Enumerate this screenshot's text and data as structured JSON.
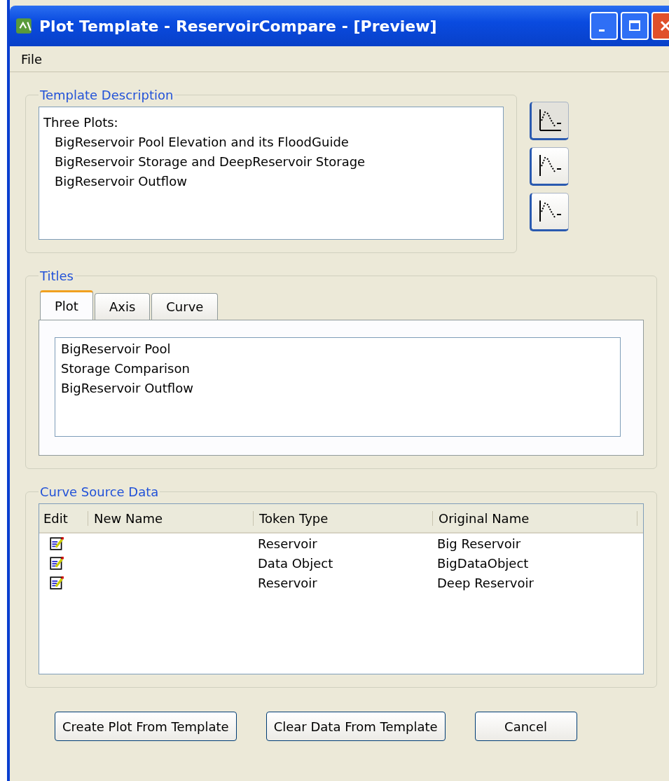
{
  "window": {
    "title": "Plot Template - ReservoirCompare - [Preview]"
  },
  "menu": [
    "File"
  ],
  "template_description": {
    "title": "Template Description",
    "heading": "Three Plots:",
    "lines": [
      "BigReservoir Pool Elevation and its FloodGuide",
      "BigReservoir Storage and DeepReservoir Storage",
      "BigReservoir Outflow"
    ],
    "plot_buttons": [
      {
        "selected": true
      },
      {
        "selected": false
      },
      {
        "selected": false
      }
    ]
  },
  "titles": {
    "title": "Titles",
    "tabs": [
      {
        "label": "Plot",
        "selected": true
      },
      {
        "label": "Axis",
        "selected": false
      },
      {
        "label": "Curve",
        "selected": false
      }
    ],
    "lines": [
      "BigReservoir Pool",
      "Storage Comparison",
      "BigReservoir Outflow"
    ]
  },
  "curve_source_data": {
    "title": "Curve Source Data",
    "columns": [
      "Edit",
      "New Name",
      "Token Type",
      "Original Name"
    ],
    "rows": [
      {
        "token_type": "Reservoir",
        "original_name": "Big Reservoir"
      },
      {
        "token_type": "Data Object",
        "original_name": "BigDataObject"
      },
      {
        "token_type": "Reservoir",
        "original_name": "Deep Reservoir"
      }
    ]
  },
  "buttons": [
    "Create Plot From Template",
    "Clear Data From Template",
    "Cancel"
  ]
}
